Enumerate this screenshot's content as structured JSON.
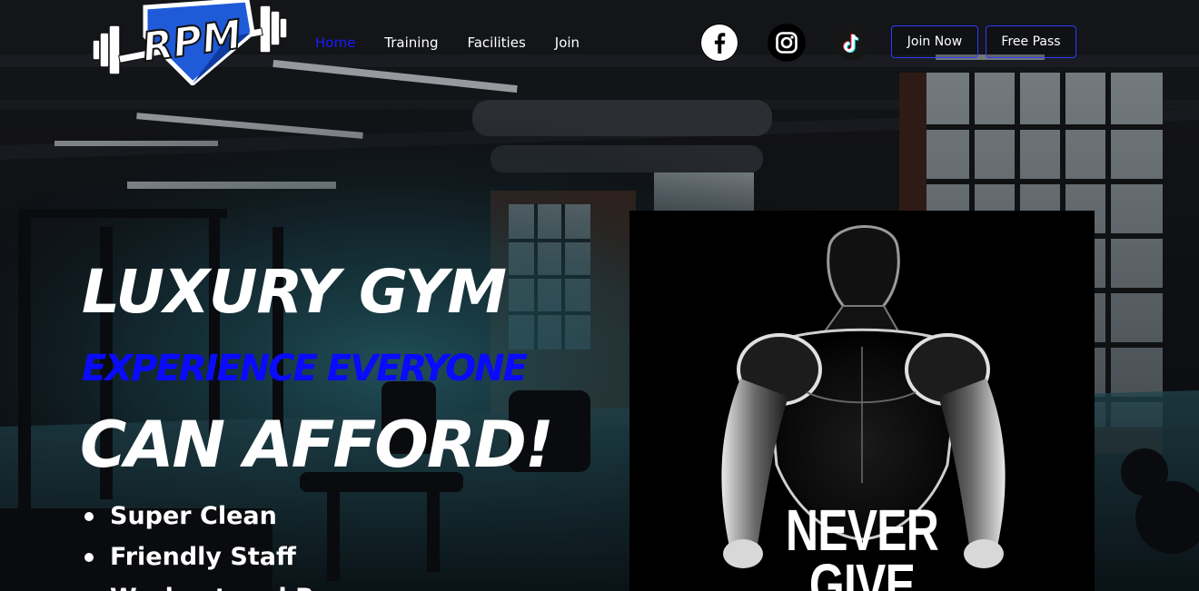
{
  "brand": {
    "logo_text": "RPM",
    "colors": {
      "accent": "#0a0aff",
      "button_border": "#2a3cff",
      "text": "#ffffff"
    }
  },
  "nav": {
    "items": [
      {
        "label": "Home",
        "active": true
      },
      {
        "label": "Training",
        "active": false
      },
      {
        "label": "Facilities",
        "active": false
      },
      {
        "label": "Join",
        "active": false
      }
    ]
  },
  "social": {
    "icons": [
      "facebook-icon",
      "instagram-icon",
      "tiktok-icon"
    ]
  },
  "buttons": {
    "join_now": "Join Now",
    "free_pass": "Free Pass"
  },
  "hero": {
    "title": "LUXURY GYM",
    "subtitle": "EXPERIENCE EVERYONE",
    "title_end": "CAN AFFORD!",
    "features": [
      "Super Clean",
      "Friendly Staff",
      "Workout and R"
    ]
  },
  "poster": {
    "caption_line1": "NEVER",
    "caption_line2": "GIVE"
  }
}
